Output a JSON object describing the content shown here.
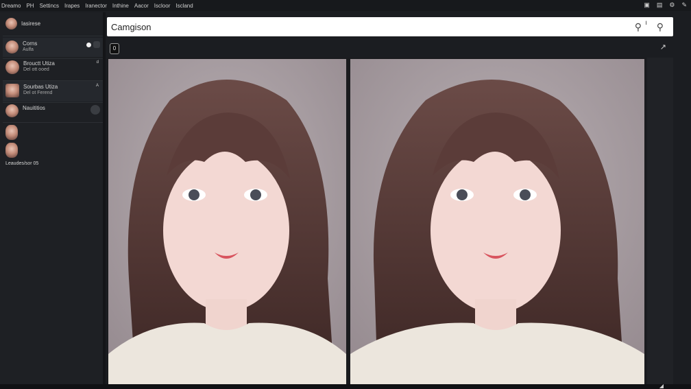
{
  "menubar": {
    "items": [
      "Dreamo",
      "PH",
      "Settincs",
      "Irapes",
      "Iranector",
      "Inthine",
      "Aacor",
      "Iscloor",
      "Iscland"
    ],
    "window_controls": [
      "minimize-icon",
      "restore-icon",
      "settings-icon",
      "pen-icon"
    ]
  },
  "sidebar": {
    "items": [
      {
        "title": "Iasirese",
        "sub": "",
        "badge": ""
      },
      {
        "title": "Corns",
        "sub": "Aulfa",
        "badge": ""
      },
      {
        "title": "Brouctt Utiza",
        "sub": "Del ott ooed",
        "badge": "d"
      },
      {
        "title": "Sourbas Utiza",
        "sub": "Del ot Ferend",
        "badge": "A"
      },
      {
        "title": "Nauititios",
        "sub": "",
        "badge": ""
      },
      {
        "title": "",
        "sub": "",
        "badge": ""
      },
      {
        "title": "",
        "sub": "",
        "badge": ""
      }
    ],
    "footer": "Leaudes/sor 05"
  },
  "search": {
    "value": "Camgison",
    "placeholder": ""
  },
  "toolbar": {
    "button_label": "0",
    "expand_icon": "expand-icon"
  },
  "colors": {
    "bg": "#1b1d21",
    "panel_bg": "#a89ea2",
    "accent": "#ffffff"
  }
}
